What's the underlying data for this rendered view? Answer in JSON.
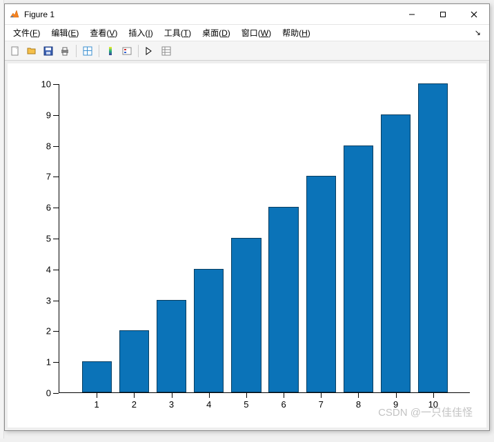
{
  "window": {
    "title": "Figure 1"
  },
  "menubar": {
    "items": [
      {
        "label": "文件",
        "key": "F"
      },
      {
        "label": "编辑",
        "key": "E"
      },
      {
        "label": "查看",
        "key": "V"
      },
      {
        "label": "插入",
        "key": "I"
      },
      {
        "label": "工具",
        "key": "T"
      },
      {
        "label": "桌面",
        "key": "D"
      },
      {
        "label": "窗口",
        "key": "W"
      },
      {
        "label": "帮助",
        "key": "H"
      }
    ]
  },
  "chart_data": {
    "type": "bar",
    "categories": [
      1,
      2,
      3,
      4,
      5,
      6,
      7,
      8,
      9,
      10
    ],
    "values": [
      1,
      2,
      3,
      4,
      5,
      6,
      7,
      8,
      9,
      10
    ],
    "xlabel": "",
    "ylabel": "",
    "title": "",
    "ylim": [
      0,
      10
    ],
    "yticks": [
      0,
      1,
      2,
      3,
      4,
      5,
      6,
      7,
      8,
      9,
      10
    ],
    "xticks": [
      1,
      2,
      3,
      4,
      5,
      6,
      7,
      8,
      9,
      10
    ],
    "bar_color": "#0b73b8"
  },
  "watermark": "CSDN @一只佳佳怪"
}
